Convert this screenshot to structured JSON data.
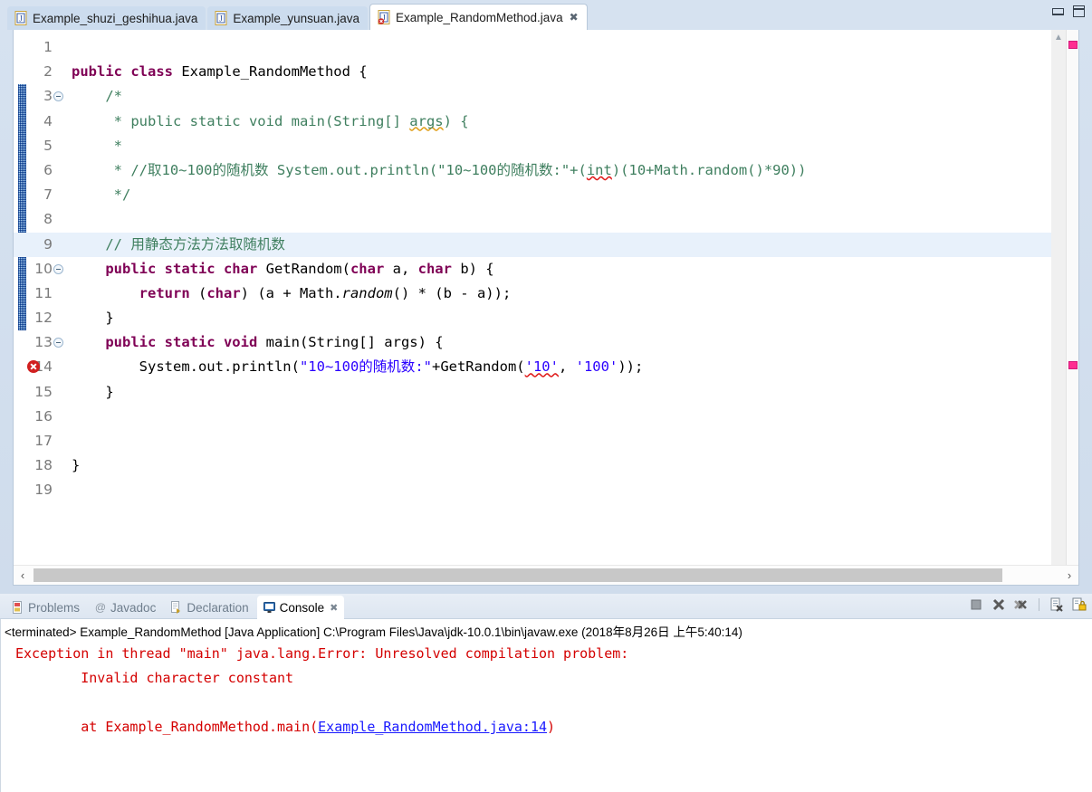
{
  "window": {
    "minimize_label": "Minimize",
    "maximize_label": "Maximize"
  },
  "editor_tabs": [
    {
      "label": "Example_shuzi_geshihua.java",
      "icon": "java-file-icon",
      "active": false,
      "closable": false
    },
    {
      "label": "Example_yunsuan.java",
      "icon": "java-file-icon",
      "active": false,
      "closable": false
    },
    {
      "label": "Example_RandomMethod.java",
      "icon": "java-file-error-icon",
      "active": true,
      "closable": true,
      "close_glyph": "✖"
    }
  ],
  "editor": {
    "lines": [
      {
        "no": "1",
        "fold": false,
        "error": false,
        "changed": false,
        "current": false,
        "segments": []
      },
      {
        "no": "2",
        "fold": false,
        "error": false,
        "changed": false,
        "current": false,
        "segments": [
          {
            "t": "public class ",
            "c": "kw"
          },
          {
            "t": "Example_RandomMethod {",
            "c": "plain"
          }
        ]
      },
      {
        "no": "3",
        "fold": true,
        "error": false,
        "changed": true,
        "current": false,
        "segments": [
          {
            "t": "    /*",
            "c": "cmt"
          }
        ]
      },
      {
        "no": "4",
        "fold": false,
        "error": false,
        "changed": true,
        "current": false,
        "segments": [
          {
            "t": "     * public static void main(String[] ",
            "c": "cmt"
          },
          {
            "t": "args",
            "c": "cmt sqc"
          },
          {
            "t": ") {",
            "c": "cmt"
          }
        ]
      },
      {
        "no": "5",
        "fold": false,
        "error": false,
        "changed": true,
        "current": false,
        "segments": [
          {
            "t": "     *",
            "c": "cmt"
          }
        ]
      },
      {
        "no": "6",
        "fold": false,
        "error": false,
        "changed": true,
        "current": false,
        "segments": [
          {
            "t": "     * //",
            "c": "cmt"
          },
          {
            "t": "取",
            "c": "cmt cjk"
          },
          {
            "t": "10~100",
            "c": "cmt"
          },
          {
            "t": "的随机数",
            "c": "cmt cjk"
          },
          {
            "t": " System.out.println(\"10~100",
            "c": "cmt"
          },
          {
            "t": "的随机数",
            "c": "cmt cjk"
          },
          {
            "t": ":\"+(",
            "c": "cmt"
          },
          {
            "t": "int",
            "c": "cmt sq"
          },
          {
            "t": ")(10+Math.random()*90))",
            "c": "cmt"
          }
        ]
      },
      {
        "no": "7",
        "fold": false,
        "error": false,
        "changed": true,
        "current": false,
        "segments": [
          {
            "t": "     */",
            "c": "cmt"
          }
        ]
      },
      {
        "no": "8",
        "fold": false,
        "error": false,
        "changed": true,
        "current": false,
        "segments": []
      },
      {
        "no": "9",
        "fold": false,
        "error": false,
        "changed": true,
        "current": true,
        "segments": [
          {
            "t": "    // ",
            "c": "cmt"
          },
          {
            "t": "用静态方法方法取随机数",
            "c": "cmt cjk"
          }
        ]
      },
      {
        "no": "10",
        "fold": true,
        "error": false,
        "changed": true,
        "current": false,
        "segments": [
          {
            "t": "    public static char ",
            "c": "kw"
          },
          {
            "t": "GetRandom(",
            "c": "plain"
          },
          {
            "t": "char ",
            "c": "kw"
          },
          {
            "t": "a, ",
            "c": "plain"
          },
          {
            "t": "char ",
            "c": "kw"
          },
          {
            "t": "b) {",
            "c": "plain"
          }
        ]
      },
      {
        "no": "11",
        "fold": false,
        "error": false,
        "changed": true,
        "current": false,
        "segments": [
          {
            "t": "        return ",
            "c": "kw"
          },
          {
            "t": "(",
            "c": "plain"
          },
          {
            "t": "char",
            "c": "kw"
          },
          {
            "t": ") (a + Math.",
            "c": "plain"
          },
          {
            "t": "random",
            "c": "plain ital"
          },
          {
            "t": "() * (b - a));",
            "c": "plain"
          }
        ]
      },
      {
        "no": "12",
        "fold": false,
        "error": false,
        "changed": true,
        "current": false,
        "segments": [
          {
            "t": "    }",
            "c": "plain"
          }
        ]
      },
      {
        "no": "13",
        "fold": true,
        "error": false,
        "changed": false,
        "current": false,
        "segments": [
          {
            "t": "    public static void ",
            "c": "kw"
          },
          {
            "t": "main(String[] args) {",
            "c": "plain"
          }
        ]
      },
      {
        "no": "14",
        "fold": false,
        "error": true,
        "changed": false,
        "current": false,
        "segments": [
          {
            "t": "        System.out.println(",
            "c": "plain"
          },
          {
            "t": "\"10~100",
            "c": "str"
          },
          {
            "t": "的随机数",
            "c": "str cjk"
          },
          {
            "t": ":\"",
            "c": "str"
          },
          {
            "t": "+GetRandom(",
            "c": "plain"
          },
          {
            "t": "'10'",
            "c": "str sq"
          },
          {
            "t": ", ",
            "c": "plain"
          },
          {
            "t": "'100'",
            "c": "str"
          },
          {
            "t": "));",
            "c": "plain"
          }
        ]
      },
      {
        "no": "15",
        "fold": false,
        "error": false,
        "changed": false,
        "current": false,
        "segments": [
          {
            "t": "    }",
            "c": "plain"
          }
        ]
      },
      {
        "no": "16",
        "fold": false,
        "error": false,
        "changed": false,
        "current": false,
        "segments": []
      },
      {
        "no": "17",
        "fold": false,
        "error": false,
        "changed": false,
        "current": false,
        "segments": []
      },
      {
        "no": "18",
        "fold": false,
        "error": false,
        "changed": false,
        "current": false,
        "segments": [
          {
            "t": "}",
            "c": "plain"
          }
        ]
      },
      {
        "no": "19",
        "fold": false,
        "error": false,
        "changed": false,
        "current": false,
        "segments": []
      }
    ],
    "scroll_up_glyph": "▲",
    "hscroll_left_glyph": "‹",
    "hscroll_right_glyph": "›",
    "overview_marker_color": "#ff2d91"
  },
  "panel_tabs": [
    {
      "label": "Problems",
      "icon": "problems-icon",
      "active": false,
      "closable": false
    },
    {
      "label": "Javadoc",
      "icon": "javadoc-icon",
      "active": false,
      "closable": false
    },
    {
      "label": "Declaration",
      "icon": "declaration-icon",
      "active": false,
      "closable": false
    },
    {
      "label": "Console",
      "icon": "console-icon",
      "active": true,
      "closable": true,
      "close_glyph": "✖"
    }
  ],
  "panel_toolbar": [
    {
      "name": "terminate-button",
      "title": "Terminate"
    },
    {
      "name": "remove-launch-button",
      "title": "Remove Launch"
    },
    {
      "name": "remove-all-terminated-button",
      "title": "Remove All Terminated Launches"
    },
    {
      "name": "clear-console-button",
      "title": "Clear Console"
    },
    {
      "name": "scroll-lock-button",
      "title": "Scroll Lock"
    }
  ],
  "console": {
    "header": "<terminated> Example_RandomMethod [Java Application] C:\\Program Files\\Java\\jdk-10.0.1\\bin\\javaw.exe (2018年8月26日 上午5:40:14)",
    "output_lines": [
      {
        "text": "Exception in thread \"main\" java.lang.Error: Unresolved compilation problem: ",
        "link": null,
        "suffix": ""
      },
      {
        "text": "\tInvalid character constant",
        "link": null,
        "suffix": ""
      },
      {
        "text": "",
        "link": null,
        "suffix": ""
      },
      {
        "text": "\tat Example_RandomMethod.main(",
        "link": "Example_RandomMethod.java:14",
        "suffix": ")"
      }
    ],
    "text_color": "#d40000",
    "link_color": "#1a1aff"
  }
}
